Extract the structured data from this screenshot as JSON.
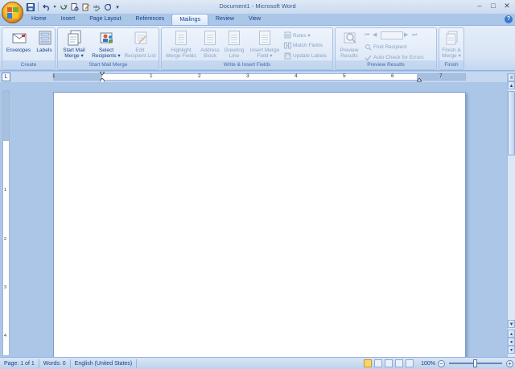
{
  "window": {
    "title": "Document1 - Microsoft Word",
    "minimize": "–",
    "maximize": "□",
    "close": "✕"
  },
  "qat": {
    "save_icon": "save-icon",
    "undo_icon": "undo-icon",
    "redo_icon": "redo-icon",
    "more": "▾"
  },
  "tabs": [
    "Home",
    "Insert",
    "Page Layout",
    "References",
    "Mailings",
    "Review",
    "View"
  ],
  "active_tab": "Mailings",
  "ribbon": {
    "create": {
      "label": "Create",
      "envelopes": "Envelopes",
      "labels": "Labels"
    },
    "start_mail_merge": {
      "label": "Start Mail Merge",
      "start_line1": "Start Mail",
      "start_line2": "Merge ▾",
      "select_line1": "Select",
      "select_line2": "Recipients ▾",
      "edit_line1": "Edit",
      "edit_line2": "Recipient List"
    },
    "write_insert": {
      "label": "Write & Insert Fields",
      "highlight_line1": "Highlight",
      "highlight_line2": "Merge Fields",
      "address_line1": "Address",
      "address_line2": "Block",
      "greeting_line1": "Greeting",
      "greeting_line2": "Line",
      "insert_line1": "Insert Merge",
      "insert_line2": "Field ▾",
      "rules": "Rules ▾",
      "match_fields": "Match Fields",
      "update_labels": "Update Labels"
    },
    "preview": {
      "label": "Preview Results",
      "preview_line1": "Preview",
      "preview_line2": "Results",
      "find_recipient": "Find Recipient",
      "auto_check": "Auto Check for Errors",
      "record_value": ""
    },
    "finish": {
      "label": "Finish",
      "finish_line1": "Finish &",
      "finish_line2": "Merge ▾"
    }
  },
  "ruler": {
    "numbers": [
      "1",
      "1",
      "2",
      "3",
      "4",
      "5",
      "6",
      "7"
    ],
    "vnumbers": [
      "1",
      "2",
      "3",
      "4"
    ]
  },
  "status": {
    "page": "Page: 1 of 1",
    "words": "Words: 0",
    "language": "English (United States)",
    "zoom": "100%"
  },
  "colors": {
    "accent": "#15428b",
    "ribbon_bg": "#dee9f7",
    "workspace": "#abc6e6"
  }
}
